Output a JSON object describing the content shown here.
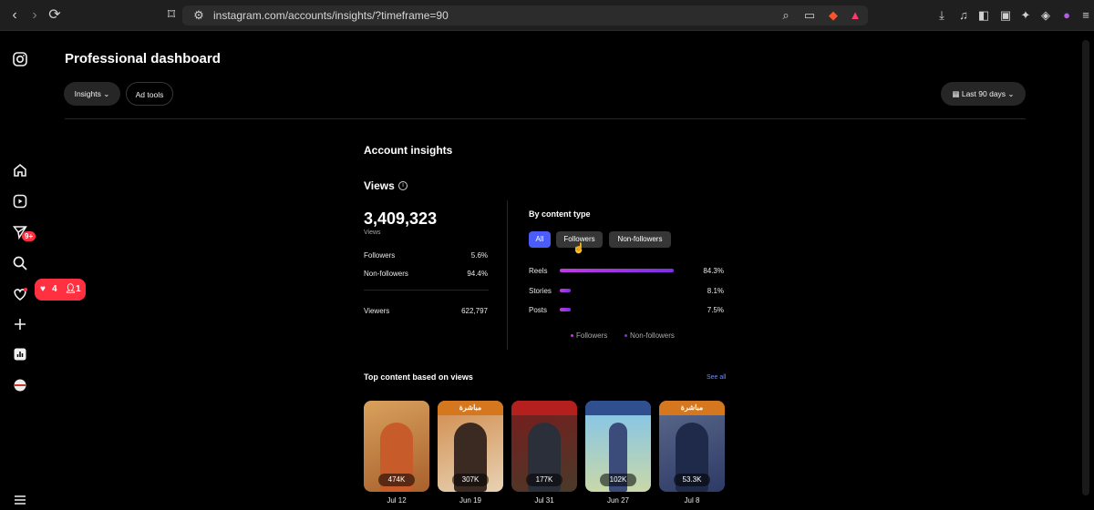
{
  "browser": {
    "url": "instagram.com/accounts/insights/?timeframe=90"
  },
  "sidebar": {
    "notification_badge": "9+",
    "activity_likes": "4",
    "activity_follows": "1"
  },
  "header": {
    "title": "Professional dashboard",
    "tabs": [
      "Insights",
      "Ad tools"
    ],
    "timeframe": "Last 90 days"
  },
  "insights": {
    "section_title": "Account insights",
    "views_title": "Views",
    "total_views": "3,409,323",
    "total_views_label": "Views",
    "rows": [
      {
        "label": "Followers",
        "value": "5.6%"
      },
      {
        "label": "Non-followers",
        "value": "94.4%"
      }
    ],
    "viewers_label": "Viewers",
    "viewers_value": "622,797",
    "by_content_type": "By content type",
    "filters": [
      "All",
      "Followers",
      "Non-followers"
    ],
    "content_types": [
      {
        "label": "Reels",
        "value": "84.3%",
        "fraction": 0.843
      },
      {
        "label": "Stories",
        "value": "8.1%",
        "fraction": 0.081
      },
      {
        "label": "Posts",
        "value": "7.5%",
        "fraction": 0.075
      }
    ],
    "legend": [
      "Followers",
      "Non-followers"
    ],
    "colors": {
      "followers": "#c13ae0",
      "non_followers": "#7b2fe6",
      "accent": "#4a5df9"
    }
  },
  "top_content": {
    "title": "Top content based on views",
    "see_all": "See all",
    "cards": [
      {
        "views": "474K",
        "date": "Jul 12",
        "banner": ""
      },
      {
        "views": "307K",
        "date": "Jun 19",
        "banner": "مباشرة"
      },
      {
        "views": "177K",
        "date": "Jul 31",
        "banner": ""
      },
      {
        "views": "102K",
        "date": "Jun 27",
        "banner": ""
      },
      {
        "views": "53.3K",
        "date": "Jul 8",
        "banner": "مباشرة"
      }
    ]
  }
}
